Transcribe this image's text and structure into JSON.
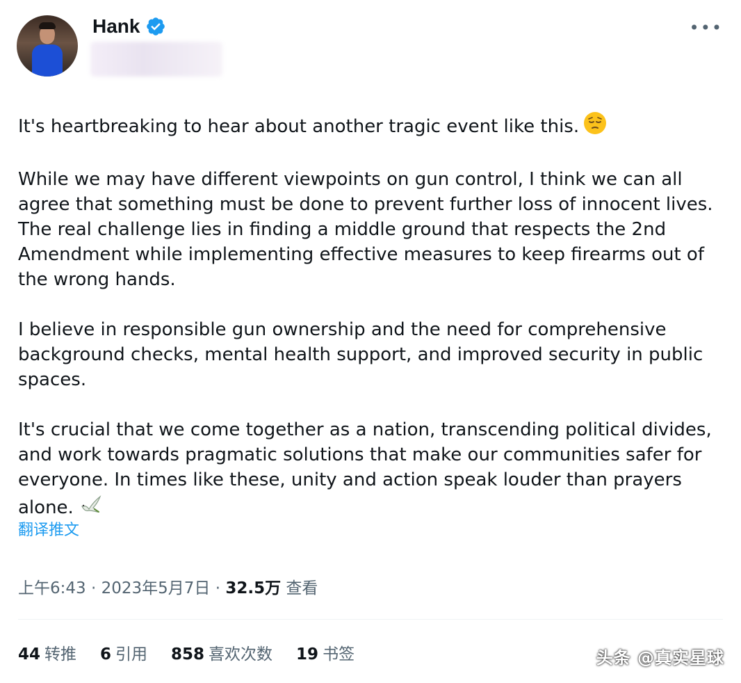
{
  "author": {
    "name": "Hank",
    "verified": true,
    "avatar_icon": "avatar-man-blue-suit"
  },
  "menu": {
    "more_label": "•••"
  },
  "tweet": {
    "paragraphs": [
      "It's heartbreaking to hear about another tragic event like this.",
      "While we may have different viewpoints on gun control, I think we can all agree that something must be done to prevent further loss of innocent lives. The real challenge lies in finding a middle ground that respects the 2nd Amendment while implementing effective measures to keep firearms out of the wrong hands.",
      "I believe in responsible gun ownership and the need for comprehensive background checks, mental health support, and improved security in public spaces.",
      "It's crucial that we come together as a nation, transcending political divides, and work towards pragmatic solutions that make our communities safer for everyone. In times like these, unity and action speak louder than prayers alone."
    ],
    "emoji_1": "pensive-face-icon",
    "emoji_2": "dove-icon",
    "translate_label": "翻译推文"
  },
  "meta": {
    "time": "上午6:43",
    "separator": " · ",
    "date": "2023年5月7日",
    "views_count": "32.5万",
    "views_label": "查看"
  },
  "stats": {
    "retweets": {
      "count": "44",
      "label": "转推"
    },
    "quotes": {
      "count": "6",
      "label": "引用"
    },
    "likes": {
      "count": "858",
      "label": "喜欢次数"
    },
    "bookmarks": {
      "count": "19",
      "label": "书签"
    }
  },
  "watermark": "头条 @真实星球",
  "colors": {
    "accent": "#1d9bf0",
    "text": "#0f1419",
    "secondary": "#536471"
  }
}
